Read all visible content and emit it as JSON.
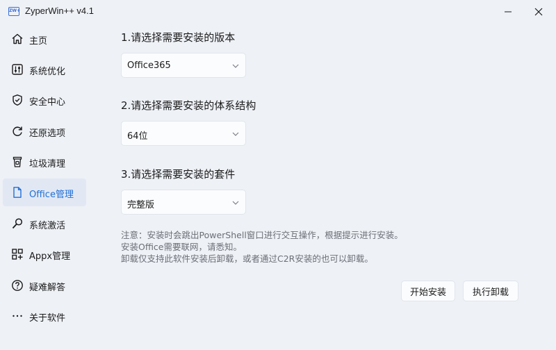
{
  "app": {
    "icon_text": "ZW+",
    "title": "ZyperWin++ v4.1"
  },
  "window_controls": {
    "minimize": "minimize",
    "close": "close"
  },
  "sidebar": {
    "items": [
      {
        "label": "主页",
        "icon": "home-icon"
      },
      {
        "label": "系统优化",
        "icon": "sliders-icon"
      },
      {
        "label": "安全中心",
        "icon": "shield-icon"
      },
      {
        "label": "还原选项",
        "icon": "refresh-icon"
      },
      {
        "label": "垃圾清理",
        "icon": "trash-icon"
      },
      {
        "label": "Office管理",
        "icon": "document-icon",
        "active": true
      },
      {
        "label": "系统激活",
        "icon": "key-icon"
      },
      {
        "label": "Appx管理",
        "icon": "apps-icon"
      },
      {
        "label": "疑难解答",
        "icon": "help-icon"
      },
      {
        "label": "关于软件",
        "icon": "more-icon"
      }
    ]
  },
  "main": {
    "step1": {
      "title": "1.请选择需要安装的版本",
      "value": "Office365"
    },
    "step2": {
      "title": "2.请选择需要安装的体系结构",
      "value": "64位"
    },
    "step3": {
      "title": "3.请选择需要安装的套件",
      "value": "完整版"
    },
    "notes": [
      "注意：安装时会跳出PowerShell窗口进行交互操作，根据提示进行安装。",
      "安装Office需要联网，请悉知。",
      "卸载仅支持此软件安装后卸载，或者通过C2R安装的也可以卸载。"
    ],
    "buttons": {
      "start_install": "开始安装",
      "uninstall": "执行卸载"
    }
  },
  "colors": {
    "accent": "#1f6fd8",
    "background": "#eef1f6",
    "active_bg": "#e2e8f3"
  }
}
